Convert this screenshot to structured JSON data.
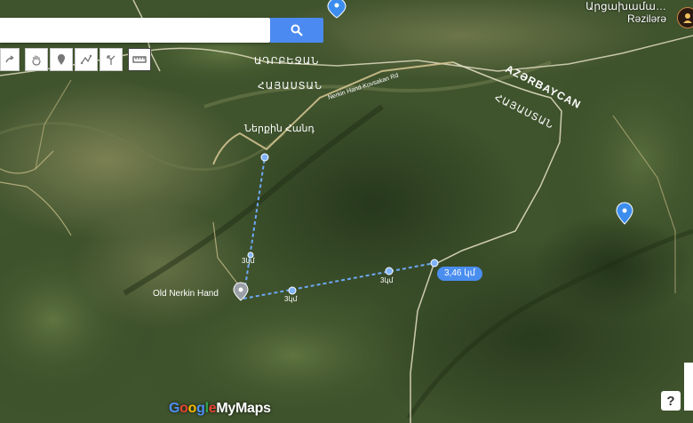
{
  "search": {
    "placeholder": ""
  },
  "toolbar": {
    "icons": [
      "redo-icon",
      "hand-icon",
      "marker-icon",
      "draw-line-icon",
      "directions-icon",
      "ruler-icon"
    ]
  },
  "user": {
    "name_line1": "Արցախամա…",
    "name_line2": "Rəzilərə"
  },
  "labels": {
    "border_country_top": "ԱԴՐԲԵՋԱՆ",
    "armenia_top": "ՀԱՅԱՍՏԱՆ",
    "road_name": "Nerkin Hand-Kovsakan Rd",
    "village_hy": "Ներքին Հանդ",
    "azerbaycan": "AZƏRBAYCAN",
    "armenia_right": "ՀԱՅԱՍՏԱՆ",
    "place_marker": "Old Nerkin Hand",
    "distance": "3,46 կմ",
    "label_small_1": "3կմ",
    "label_small_2": "3կմ",
    "label_small_3": "3կմ"
  },
  "branding": {
    "logo": "GoogleMyMaps",
    "logo_parts": [
      "G",
      "o",
      "o",
      "g",
      "l",
      "e"
    ],
    "logo_tail": "MyMaps"
  },
  "help": "?",
  "colors": {
    "terrain_dark": "#2f4222",
    "terrain_mid": "#4e6636",
    "terrain_light": "#7c8a56",
    "pin_blue": "#3c8ded",
    "measure_line": "#6ea8f5"
  }
}
